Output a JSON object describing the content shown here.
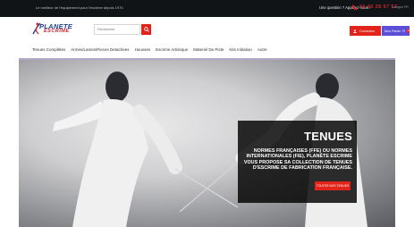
{
  "topbar": {
    "tagline": "Le meilleur de l'équipement pour l'escrime depuis 1970",
    "question": "Une question ? Appelez-nous !",
    "phone": "01 60 28 57 57",
    "language": "Langue FR"
  },
  "header": {
    "logo_line1": "PLANETE",
    "logo_line2": "ESCRIME",
    "search_placeholder": "Rechercher",
    "connexion_label": "Connexion",
    "panier_label": "Mon Panier",
    "panier_count": "0"
  },
  "nav": {
    "items": [
      "Tenues Complètes",
      "Armes/Lames/Pieces Detachees",
      "Housses",
      "Escrime Artistique",
      "Materiel De Piste",
      "Kits Initiation",
      "Autre"
    ]
  },
  "hero": {
    "title": "TENUES",
    "text_lines": [
      "NORMES FRANÇAISES (FFE) OU NORMES",
      "INTERNATIONALES (FIE), PLANÈTE ESCRIME",
      "VOUS PROPOSE SA COLLECTION DE TENUES",
      "D'ESCRIME DE FABRICATION FRANÇAISE."
    ],
    "cta": "TOUTES NOS TENUES"
  },
  "colors": {
    "accent_red": "#e2231a",
    "cart_purple": "#5a4fd6",
    "topbar_bg": "#111416",
    "logo_blue": "#1e3f8f"
  }
}
